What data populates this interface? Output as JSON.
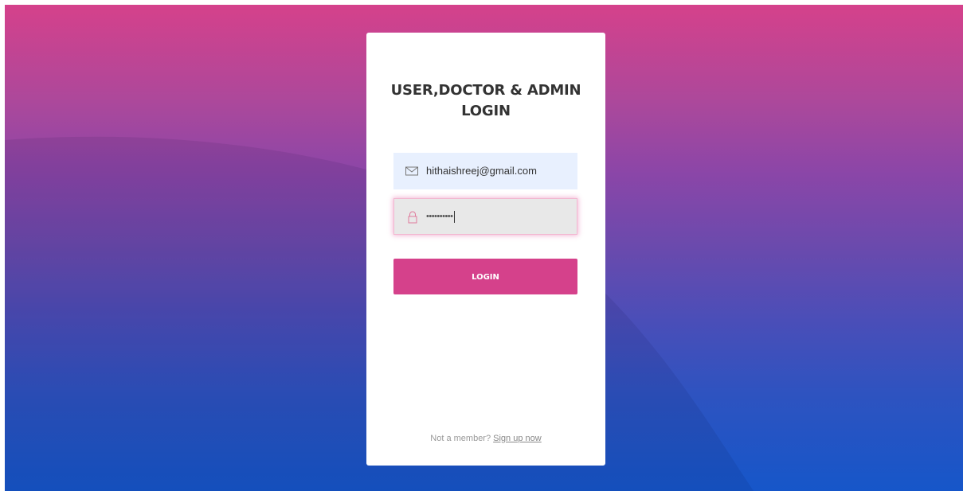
{
  "login_card": {
    "title": "USER,DOCTOR & ADMIN LOGIN",
    "email": {
      "icon": "envelope-icon",
      "value": "hithaishreej@gmail.com"
    },
    "password": {
      "icon": "lock-icon",
      "value": "••••••••••"
    },
    "login_button_label": "LOGIN",
    "footer": {
      "prompt": "Not a member?",
      "signup_link": "Sign up now"
    }
  },
  "colors": {
    "accent": "#d5418b",
    "gradient_top": "#d5418b",
    "gradient_bottom": "#1656c9",
    "autofill_bg": "#e8f0fe"
  }
}
